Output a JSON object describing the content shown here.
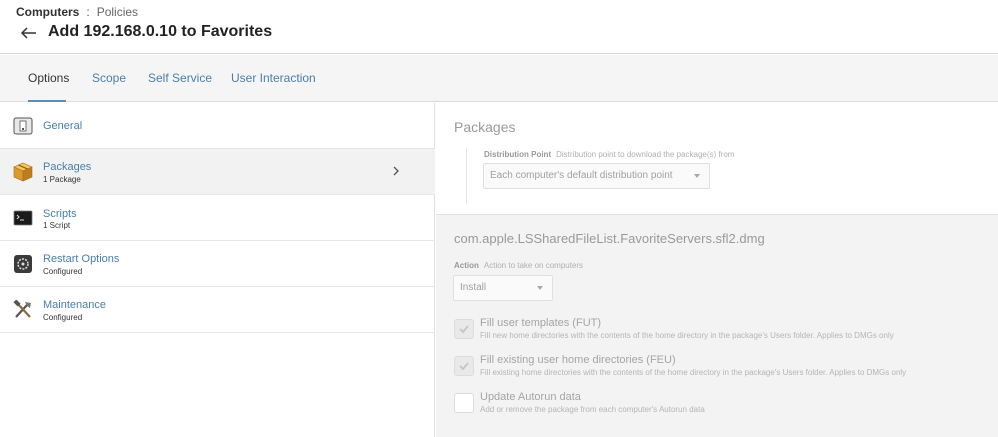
{
  "header": {
    "breadcrumb_root": "Computers",
    "breadcrumb_sep": ":",
    "breadcrumb_leaf": "Policies",
    "title": "Add 192.168.0.10 to Favorites"
  },
  "tabs": [
    {
      "label": "Options",
      "active": true
    },
    {
      "label": "Scope",
      "active": false
    },
    {
      "label": "Self Service",
      "active": false
    },
    {
      "label": "User Interaction",
      "active": false
    }
  ],
  "sidebar": {
    "items": [
      {
        "title": "General",
        "subtitle": "",
        "icon": "general-icon"
      },
      {
        "title": "Packages",
        "subtitle": "1 Package",
        "icon": "packages-icon",
        "selected": true
      },
      {
        "title": "Scripts",
        "subtitle": "1 Script",
        "icon": "terminal-icon"
      },
      {
        "title": "Restart Options",
        "subtitle": "Configured",
        "icon": "restart-icon"
      },
      {
        "title": "Maintenance",
        "subtitle": "Configured",
        "icon": "tools-icon"
      }
    ]
  },
  "packages": {
    "section_title": "Packages",
    "distribution_label": "Distribution Point",
    "distribution_desc": "Distribution point to download the package(s) from",
    "distribution_value": "Each computer's default distribution point"
  },
  "package_detail": {
    "name": "com.apple.LSSharedFileList.FavoriteServers.sfl2.dmg",
    "action_label": "Action",
    "action_desc": "Action to take on computers",
    "action_value": "Install",
    "options": [
      {
        "label": "Fill user templates (FUT)",
        "desc": "Fill new home directories with the contents of the home directory in the package's Users folder. Applies to DMGs only",
        "checked": true
      },
      {
        "label": "Fill existing user home directories (FEU)",
        "desc": "Fill existing home directories with the contents of the home directory in the package's Users folder. Applies to DMGs only",
        "checked": true
      },
      {
        "label": "Update Autorun data",
        "desc": "Add or remove the package from each computer's Autorun data",
        "checked": false
      }
    ]
  },
  "colors": {
    "link": "#4a7fa8",
    "tab_underline": "#5b8db8",
    "panel_bg": "#f3f3f3"
  }
}
